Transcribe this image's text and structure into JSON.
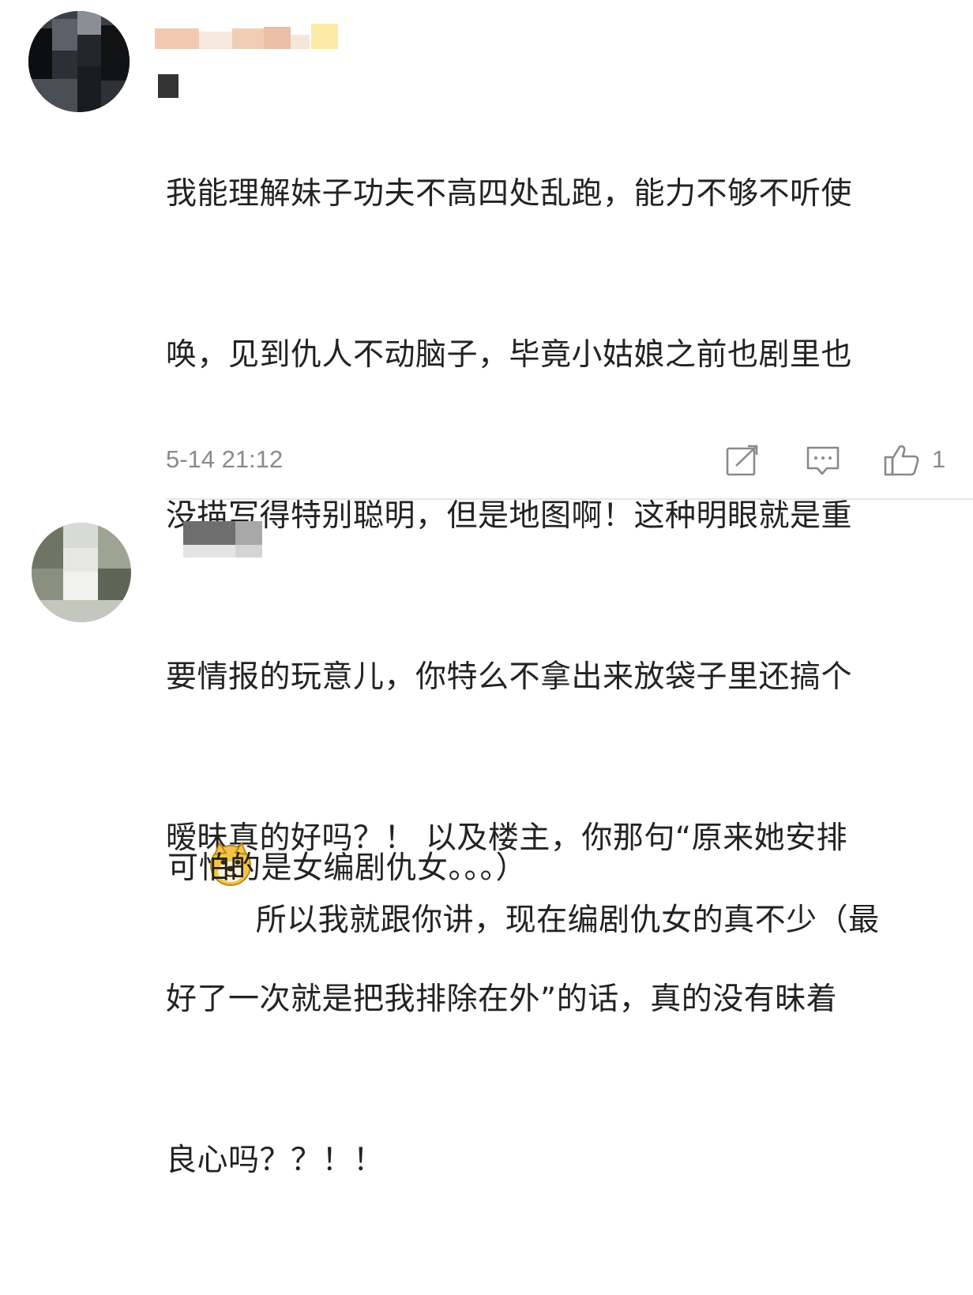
{
  "comments": [
    {
      "username": "",
      "text_lines": [
        "我能理解妹子功夫不高四处乱跑，能力不够不听使",
        "唤，见到仇人不动脑子，毕竟小姑娘之前也剧里也",
        "没描写得特别聪明，但是地图啊！这种明眼就是重",
        "要情报的玩意儿，你特么不拿出来放袋子里还搞个",
        "暧昧真的好吗？！ 以及楼主，你那句“原来她安排",
        "好了一次就是把我排除在外”的话，真的没有昧着",
        "良心吗？？！！"
      ],
      "timestamp": "5-14 21:12",
      "like_count": "1",
      "icons": [
        "share-icon",
        "reply-icon",
        "like-icon"
      ]
    },
    {
      "username": "",
      "emoji": "doge-emoji",
      "text_lines": [
        "所以我就跟你讲，现在编剧仇女的真不少（最",
        "可怕的是女编剧仇女。。。）"
      ]
    }
  ],
  "colors": {
    "text": "#222222",
    "meta": "#8a8a8a",
    "divider": "#e6e6e6",
    "background": "#ffffff"
  }
}
